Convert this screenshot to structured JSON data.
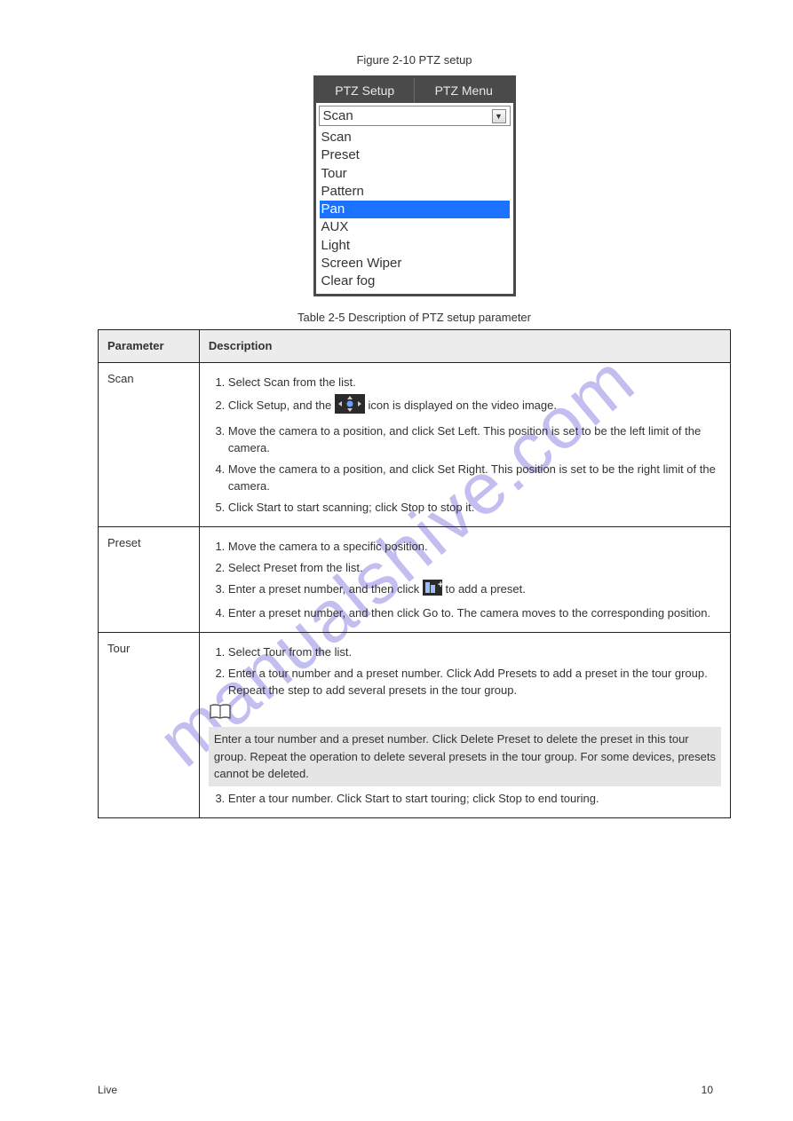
{
  "watermark": "manualshive.com",
  "figure_caption": "Figure 2-10 PTZ setup",
  "panel": {
    "tabs": {
      "setup": "PTZ Setup",
      "menu": "PTZ Menu"
    },
    "selected": "Scan",
    "options": {
      "o0": "Scan",
      "o1": "Preset",
      "o2": "Tour",
      "o3": "Pattern",
      "o4": "Pan",
      "o5": "AUX",
      "o6": "Light",
      "o7": "Screen Wiper",
      "o8": "Clear fog"
    }
  },
  "table_caption": "Table 2-5 Description of PTZ setup parameter",
  "headers": {
    "param": "Parameter",
    "desc": "Description"
  },
  "rows": {
    "scan": {
      "param": "Scan",
      "s1": "Select Scan from the list.",
      "s2_a": "Click Setup, and the ",
      "s2_b": "icon is displayed on the video image.",
      "s3": "Move the camera to a position, and click Set Left. This position is set to be the left limit of the camera.",
      "s4": "Move the camera to a position, and click Set Right. This position is set to be the right limit of the camera.",
      "s5": "Click Start to start scanning; click Stop to stop it."
    },
    "preset": {
      "param": "Preset",
      "s1": "Move the camera to a specific position.",
      "s2": "Select Preset from the list.",
      "s3_a": "Enter a preset number, and then click ",
      "s3_b": "to add a preset.",
      "s4": "Enter a preset number, and then click Go to. The camera moves to the corresponding position."
    },
    "tour": {
      "param": "Tour",
      "s1": "Select Tour from the list.",
      "s2": "Enter a tour number and a preset number. Click Add Presets to add a preset in the tour group. Repeat the step to add several presets in the tour group.",
      "note": "Enter a tour number and a preset number. Click Delete Preset to delete the preset in this tour group. Repeat the operation to delete several presets in the tour group. For some devices, presets cannot be deleted.",
      "s3": "Enter a tour number. Click Start to start touring; click Stop to end touring."
    }
  },
  "footer": {
    "left": "Live",
    "right": "10"
  }
}
